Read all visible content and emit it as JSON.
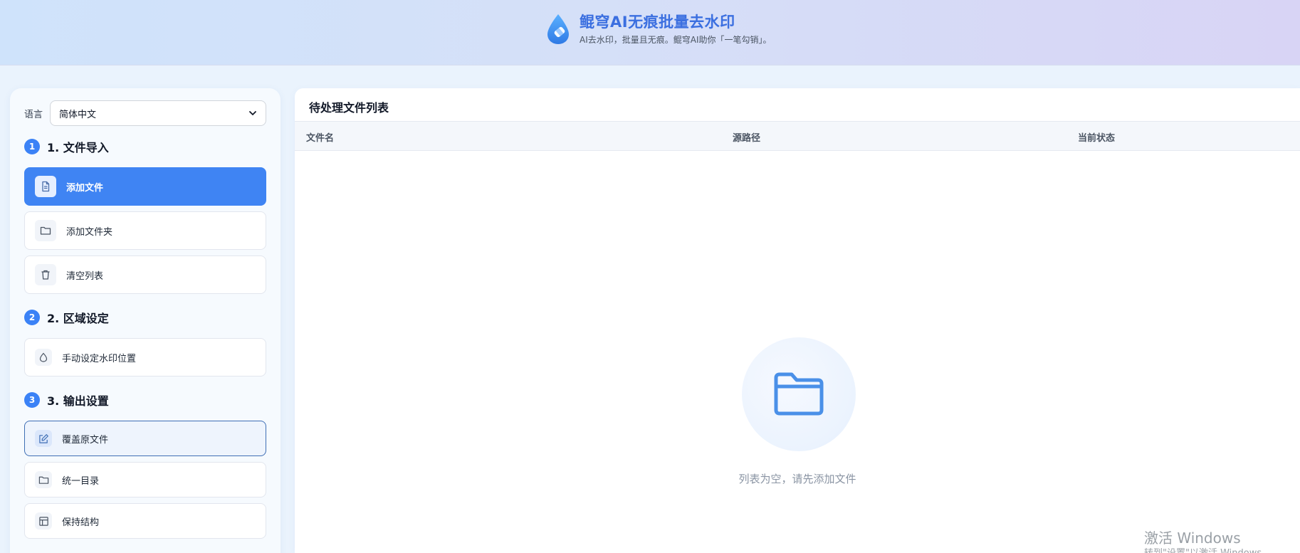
{
  "header": {
    "title": "鲲穹AI无痕批量去水印",
    "subtitle": "AI去水印，批量且无痕。鲲穹AI助你「一笔勾销」。"
  },
  "sidebar": {
    "language_label": "语言",
    "language_selected": "简体中文",
    "sections": [
      {
        "num": "1",
        "title": "1. 文件导入"
      },
      {
        "num": "2",
        "title": "2. 区域设定"
      },
      {
        "num": "3",
        "title": "3. 输出设置"
      }
    ],
    "import_buttons": [
      {
        "label": "添加文件",
        "icon": "file-icon"
      },
      {
        "label": "添加文件夹",
        "icon": "folder-icon"
      },
      {
        "label": "清空列表",
        "icon": "trash-icon"
      }
    ],
    "region_buttons": [
      {
        "label": "手动设定水印位置",
        "icon": "droplet-icon"
      }
    ],
    "output_buttons": [
      {
        "label": "覆盖原文件",
        "icon": "edit-icon"
      },
      {
        "label": "统一目录",
        "icon": "folder-icon"
      },
      {
        "label": "保持结构",
        "icon": "layout-icon"
      }
    ]
  },
  "main": {
    "title": "待处理文件列表",
    "columns": [
      "文件名",
      "源路径",
      "当前状态"
    ],
    "empty_text": "列表为空，请先添加文件"
  },
  "os_watermark": {
    "line1": "激活 Windows",
    "line2": "转到\"设置\"以激活 Windows。"
  },
  "colors": {
    "accent": "#3f84f3",
    "brand_title": "#3b6fe0",
    "selected_border": "#3f6fb5"
  }
}
